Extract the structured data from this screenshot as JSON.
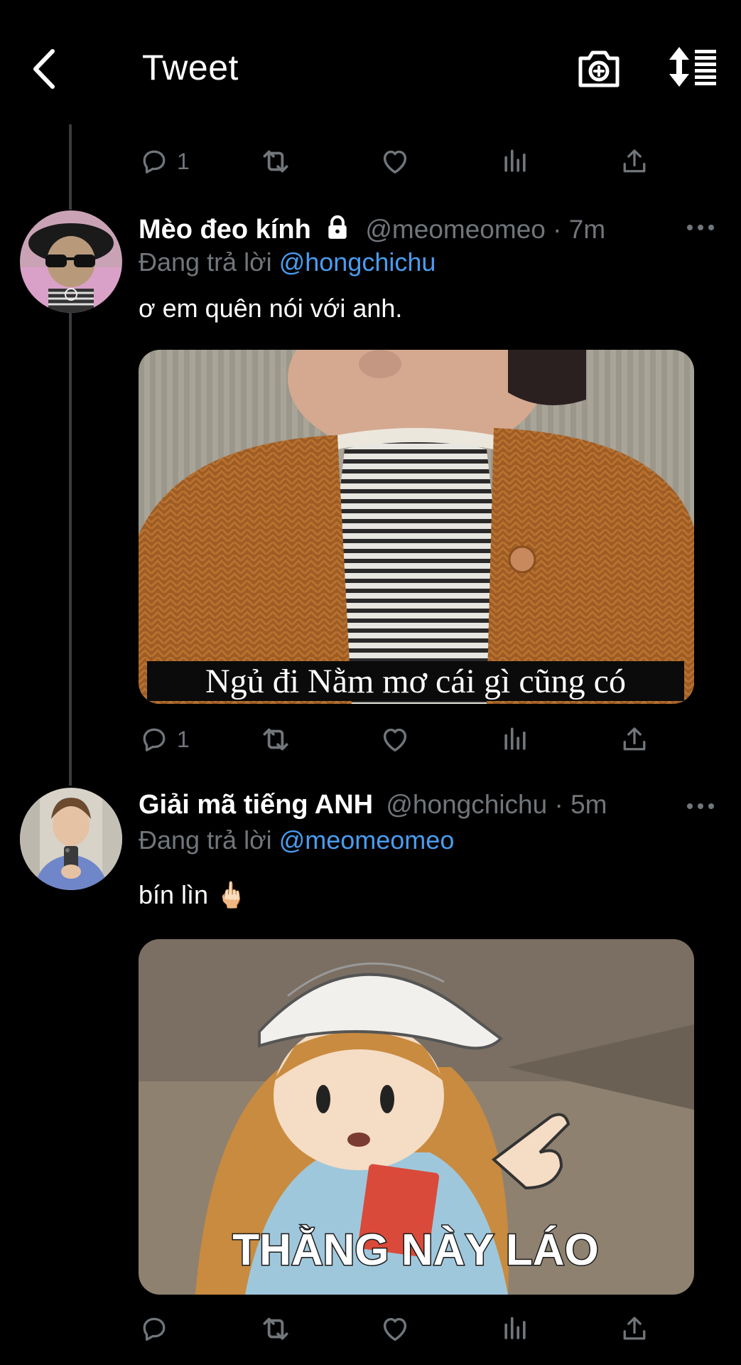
{
  "header": {
    "title": "Tweet",
    "back_icon": "chevron-left-icon",
    "camera_icon": "camera-plus-icon",
    "sort_icon": "sort-list-icon"
  },
  "colors": {
    "background": "#000000",
    "text_primary": "#ffffff",
    "text_secondary": "#71767b",
    "mention": "#4a9cf0",
    "thread_line": "#3a3b3e"
  },
  "top_actions": {
    "reply_count": "1"
  },
  "tweets": [
    {
      "display_name": "Mèo đeo kính",
      "locked": true,
      "handle": "@meomeomeo",
      "time": "· 7m",
      "reply_prefix": "Đang trả lời",
      "reply_mention": "@hongchichu",
      "text": "ơ em quên nói với anh.",
      "media_caption": "Ngủ đi Nằm mơ cái gì cũng có",
      "reply_count": "1"
    },
    {
      "display_name": "Giải mã tiếng ANH",
      "locked": false,
      "handle": "@hongchichu",
      "time": "· 5m",
      "reply_prefix": "Đang trả lời",
      "reply_mention": "@meomeomeo",
      "text": "bín lìn 🖕🏻",
      "media_caption": "THẰNG NÀY LÁO",
      "reply_count": ""
    }
  ]
}
